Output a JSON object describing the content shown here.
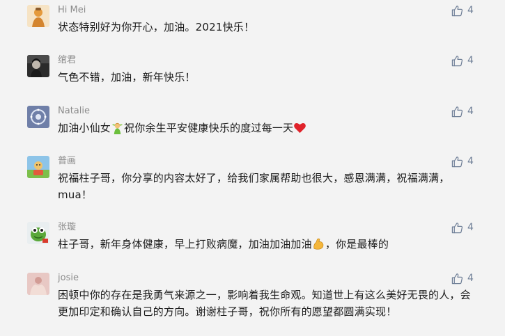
{
  "comments": [
    {
      "name": "Hi Mei",
      "text": "状态特别好为你开心，加油。2021快乐！",
      "likes": "4",
      "avatar": "avatar-orange-figure"
    },
    {
      "name": "绾君",
      "text": "气色不错，加油，新年快乐！",
      "likes": "4",
      "avatar": "avatar-dark-portrait"
    },
    {
      "name": "Natalie",
      "text_before_emoji": "加油小仙女",
      "emoji_1": "fairy-emoji",
      "text_after_emoji": "祝你余生平安健康快乐的度过每一天",
      "emoji_2": "heart-emoji",
      "likes": "4",
      "avatar": "avatar-blue-circle"
    },
    {
      "name": "普画",
      "text": "祝福柱子哥，你分享的内容太好了，给我们家属帮助也很大，感恩满满，祝福满满，mua！",
      "likes": "4",
      "avatar": "avatar-cartoon-outdoor"
    },
    {
      "name": "张璇",
      "text_before_emoji": "柱子哥，新年身体健康，早上打败病魔，加油加油加油",
      "emoji_1": "flexed-biceps-emoji",
      "text_after_emoji": "，你是最棒的",
      "likes": "4",
      "avatar": "avatar-green-frog"
    },
    {
      "name": "josie",
      "text": "困顿中你的存在是我勇气来源之一，影响着我生命观。知道世上有这么美好无畏的人，会更加印定和确认自己的方向。谢谢柱子哥，祝你所有的愿望都圆满实现！",
      "likes": "4",
      "avatar": "avatar-pink-hands"
    }
  ],
  "colors": {
    "background": "#f3f3f3",
    "name": "#8b8b8b",
    "text": "#1b1b1b",
    "like": "#6f7f97"
  },
  "icons": {
    "like": "thumbs-up-icon"
  }
}
